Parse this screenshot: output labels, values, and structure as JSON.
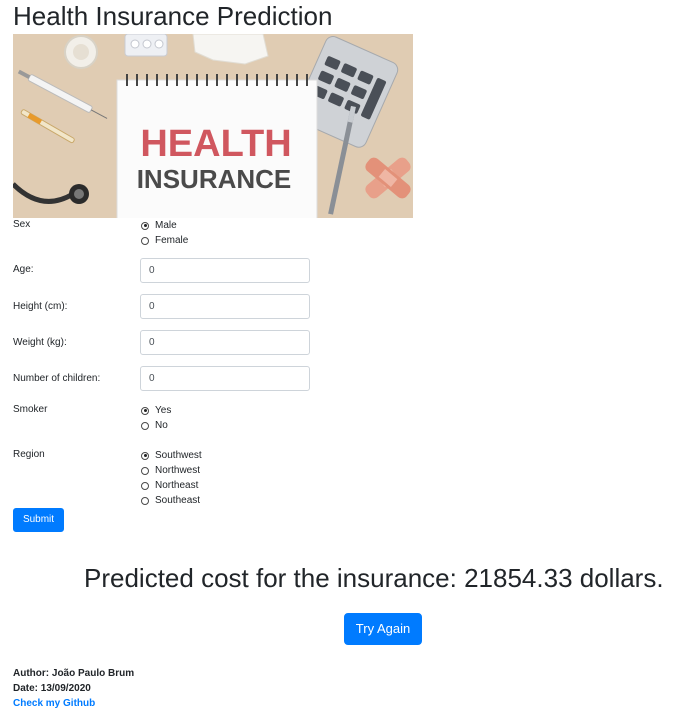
{
  "page": {
    "title": "Health Insurance Prediction"
  },
  "hero": {
    "line1": "HEALTH",
    "line2": "INSURANCE"
  },
  "form": {
    "sex": {
      "label": "Sex",
      "options": [
        "Male",
        "Female"
      ],
      "selected": "Male"
    },
    "age": {
      "label": "Age:",
      "value": "0"
    },
    "height": {
      "label": "Height (cm):",
      "value": "0"
    },
    "weight": {
      "label": "Weight (kg):",
      "value": "0"
    },
    "children": {
      "label": "Number of children:",
      "value": "0"
    },
    "smoker": {
      "label": "Smoker",
      "options": [
        "Yes",
        "No"
      ],
      "selected": "Yes"
    },
    "region": {
      "label": "Region",
      "options": [
        "Southwest",
        "Northwest",
        "Northeast",
        "Southeast"
      ],
      "selected": "Southwest"
    },
    "submit_label": "Submit"
  },
  "result": {
    "prediction_text": "Predicted cost for the insurance: 21854.33 dollars.",
    "try_again_label": "Try Again"
  },
  "footer": {
    "author": "Author: João Paulo Brum",
    "date": "Date: 13/09/2020",
    "github_link": "Check my Github"
  },
  "colors": {
    "primary": "#007bff",
    "text": "#212529",
    "hero_text": "#d0575f",
    "hero_text2": "#4a4a4a"
  }
}
